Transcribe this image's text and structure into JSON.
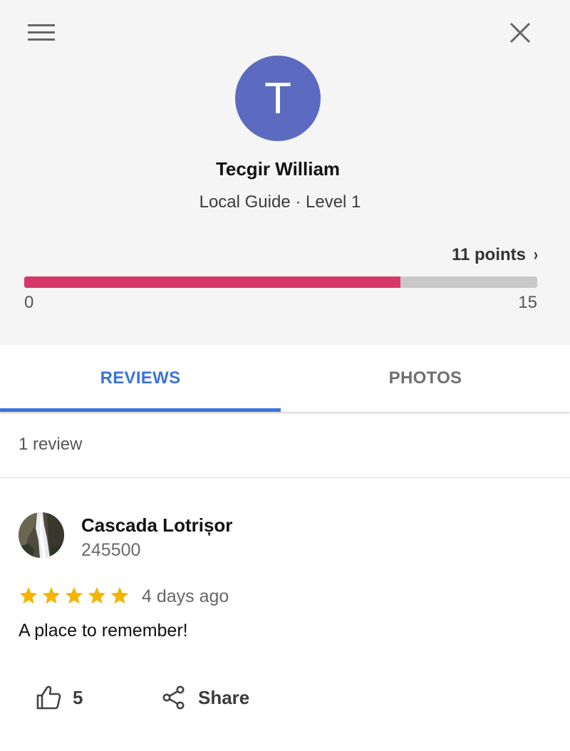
{
  "colors": {
    "avatar_bg": "#5c6bc0",
    "progress_fill": "#d7386a",
    "tab_active": "#3b74d9",
    "tab_inactive": "#707070",
    "star": "#f4b400"
  },
  "header": {
    "menu_icon": "hamburger-menu-icon",
    "close_icon": "close-icon"
  },
  "profile": {
    "avatar_initial": "T",
    "name": "Tecgir William",
    "level": "Local Guide · Level 1",
    "points_label": "11 points",
    "points_chevron": "›",
    "progress_fraction": 0.7333,
    "scale_min": "0",
    "scale_max": "15"
  },
  "tabs": [
    {
      "label": "REVIEWS",
      "active": true
    },
    {
      "label": "PHOTOS",
      "active": false
    }
  ],
  "reviews_summary": "1 review",
  "review": {
    "place_name": "Cascada Lotrișor",
    "place_code": "245500",
    "rating": 5,
    "time": "4 days ago",
    "text": "A place to remember!",
    "like_icon": "thumbs-up-icon",
    "like_count": "5",
    "share_icon": "share-icon",
    "share_label": "Share"
  }
}
